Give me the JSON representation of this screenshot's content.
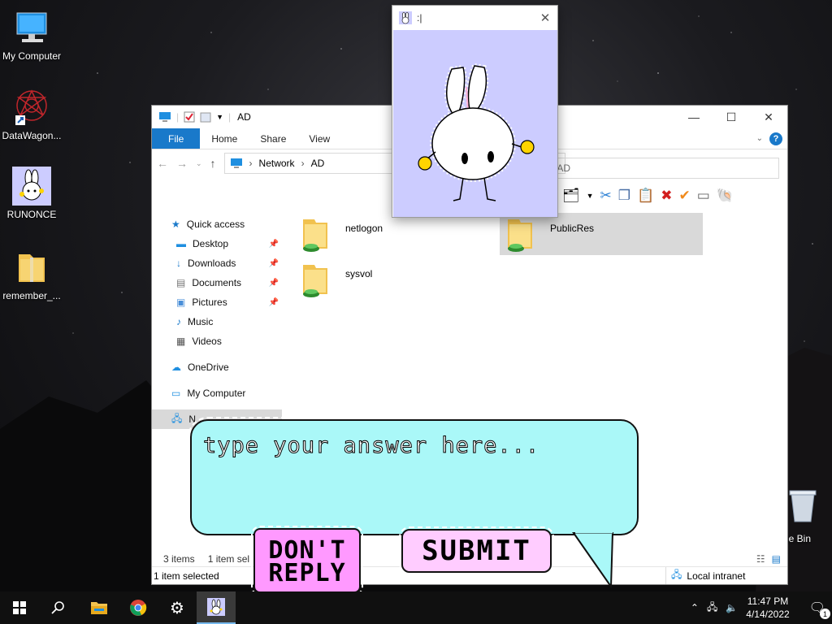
{
  "desktop": {
    "icons": [
      {
        "label": "My Computer"
      },
      {
        "label": "DataWagon..."
      },
      {
        "label": "RUNONCE"
      },
      {
        "label": "remember_..."
      }
    ],
    "recycle_label": "cle Bin"
  },
  "explorer": {
    "title": "AD",
    "ribbon_tabs": [
      "File",
      "Home",
      "Share",
      "View"
    ],
    "address": [
      "Network",
      "AD"
    ],
    "search_placeholder": "h AD",
    "nav": {
      "quick_access": "Quick access",
      "items": [
        "Desktop",
        "Downloads",
        "Documents",
        "Pictures",
        "Music",
        "Videos"
      ],
      "onedrive": "OneDrive",
      "mycomputer": "My Computer",
      "network": "N"
    },
    "files": [
      {
        "name": "netlogon"
      },
      {
        "name": "sysvol"
      },
      {
        "name": "PublicRes"
      }
    ],
    "status_count": "3 items",
    "status_selected_short": "1 item sel",
    "status_selected": "1 item selected",
    "zone": "Local intranet"
  },
  "bunny": {
    "title": ":|"
  },
  "dialog": {
    "placeholder": "type your answer here...",
    "dont_reply_line1": "DON'T",
    "dont_reply_line2": "REPLY",
    "submit": "SUBMIT"
  },
  "taskbar": {
    "time": "11:47 PM",
    "date": "4/14/2022",
    "notifications": "1"
  },
  "colors": {
    "file_tab": "#1979ca",
    "bunny_bg": "#ccccff",
    "bubble": "#aaf8f8",
    "dont_reply": "#ff99ff",
    "submit": "#ffccff"
  }
}
